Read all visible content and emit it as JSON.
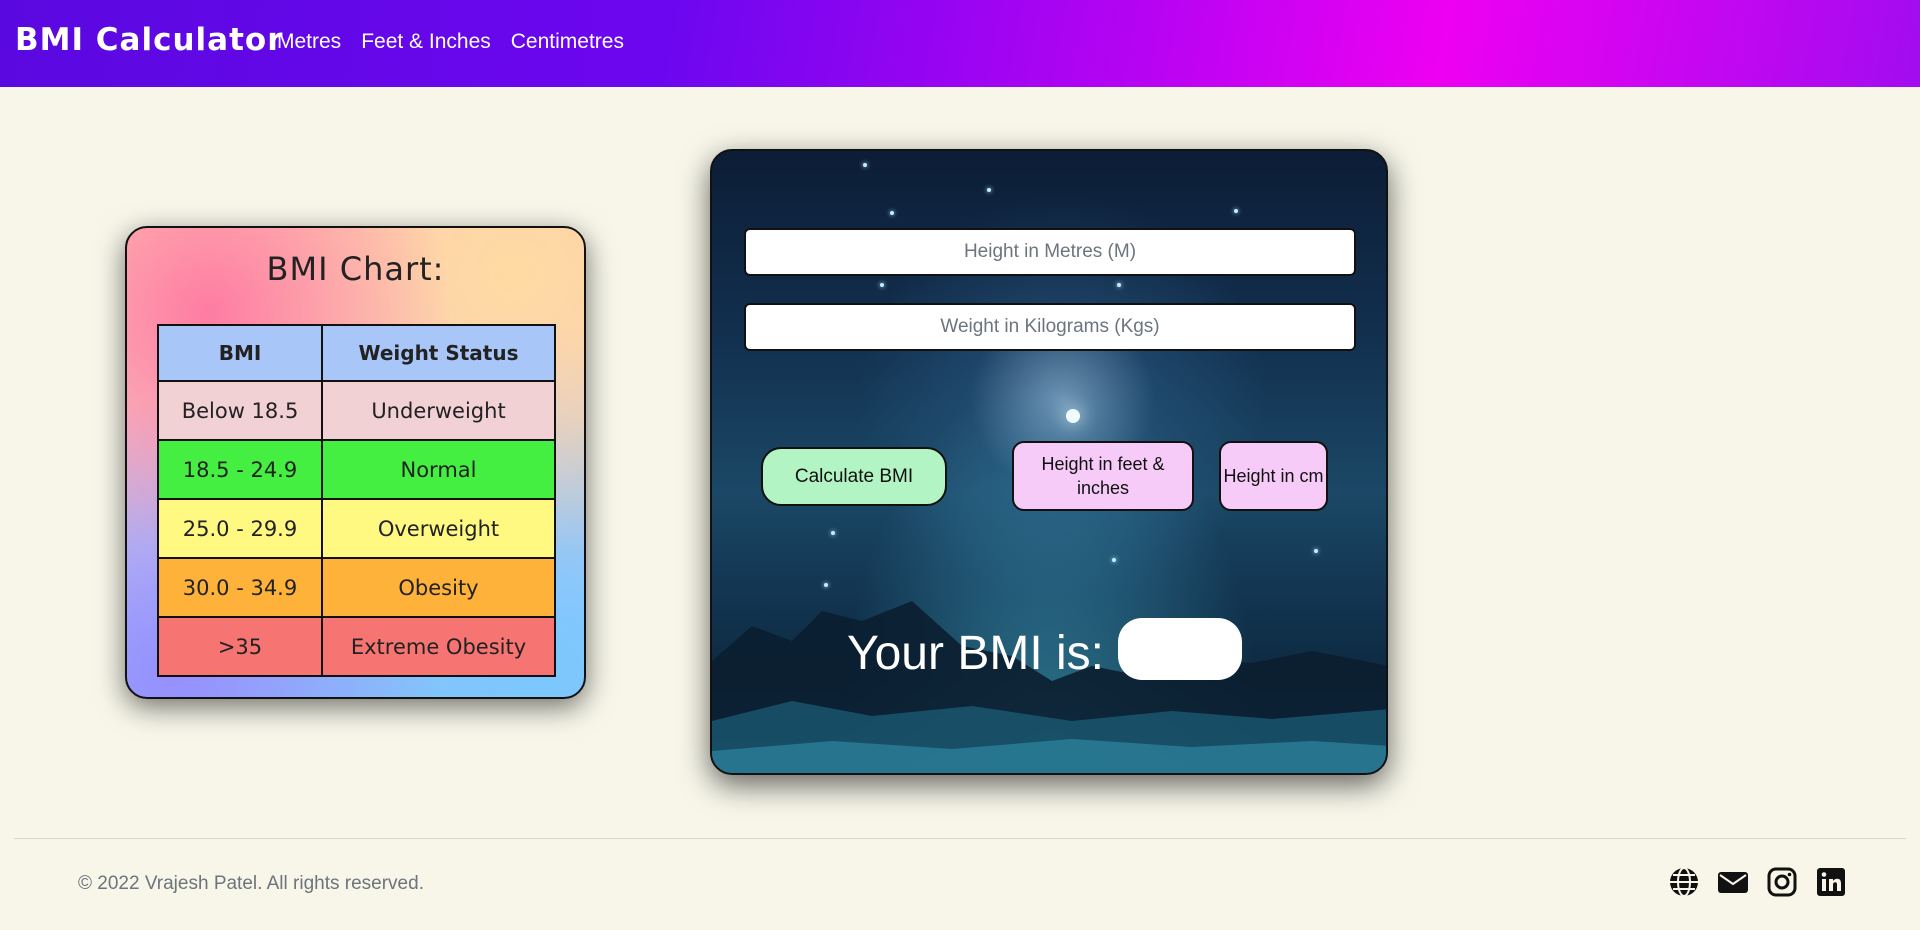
{
  "navbar": {
    "brand": "BMI Calculator",
    "links": [
      "Metres",
      "Feet & Inches",
      "Centimetres"
    ]
  },
  "chart": {
    "title": "BMI Chart:",
    "headers": [
      "BMI",
      "Weight Status"
    ],
    "rows": [
      [
        "Below 18.5",
        "Underweight"
      ],
      [
        "18.5 - 24.9",
        "Normal"
      ],
      [
        "25.0 - 29.9",
        "Overweight"
      ],
      [
        "30.0 - 34.9",
        "Obesity"
      ],
      [
        ">35",
        "Extreme Obesity"
      ]
    ],
    "row_colors": [
      "#f2d1d5",
      "#44ef42",
      "#fff982",
      "#ffb23a",
      "#f67472"
    ],
    "header_color": "#a9c6f8"
  },
  "calculator": {
    "height_placeholder": "Height in Metres (M)",
    "weight_placeholder": "Weight in Kilograms (Kgs)",
    "calculate_label": "Calculate BMI",
    "feet_label": "Height in feet & inches",
    "cm_label": "Height in cm",
    "result_label": "Your BMI is:",
    "result_value": ""
  },
  "footer": {
    "copyright": "© 2022 Vrajesh Patel. All rights reserved.",
    "socials": [
      "globe-icon",
      "mail-icon",
      "instagram-icon",
      "linkedin-icon"
    ]
  },
  "colors": {
    "page_bg": "#f7f6e9",
    "calc_button": "#b2f4c3",
    "alt_button": "#f6cbf8"
  }
}
